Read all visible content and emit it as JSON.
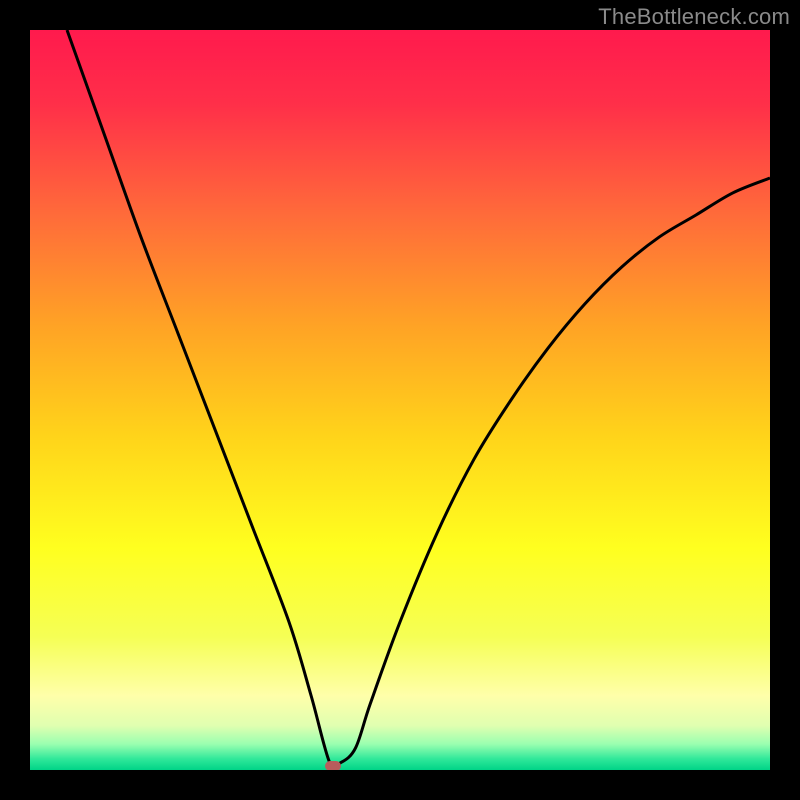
{
  "watermark": "TheBottleneck.com",
  "chart_data": {
    "type": "line",
    "title": "",
    "xlabel": "",
    "ylabel": "",
    "xlim": [
      0,
      100
    ],
    "ylim": [
      0,
      100
    ],
    "grid": false,
    "legend": false,
    "series": [
      {
        "name": "bottleneck-curve",
        "x": [
          5,
          10,
          15,
          20,
          25,
          30,
          35,
          38,
          40.5,
          42,
          44,
          46,
          50,
          55,
          60,
          65,
          70,
          75,
          80,
          85,
          90,
          95,
          100
        ],
        "y": [
          100,
          86,
          72,
          59,
          46,
          33,
          20,
          10,
          1,
          1,
          3,
          9,
          20,
          32,
          42,
          50,
          57,
          63,
          68,
          72,
          75,
          78,
          80
        ]
      }
    ],
    "marker": {
      "x": 41,
      "y": 0.5,
      "color": "#b85c5c"
    },
    "background_gradient_stops": [
      {
        "offset": 0.0,
        "color": "#ff1a4d"
      },
      {
        "offset": 0.1,
        "color": "#ff2f49"
      },
      {
        "offset": 0.25,
        "color": "#ff6b3a"
      },
      {
        "offset": 0.4,
        "color": "#ffa325"
      },
      {
        "offset": 0.55,
        "color": "#ffd41a"
      },
      {
        "offset": 0.7,
        "color": "#ffff1f"
      },
      {
        "offset": 0.82,
        "color": "#f5ff55"
      },
      {
        "offset": 0.9,
        "color": "#ffffaa"
      },
      {
        "offset": 0.94,
        "color": "#e0ffb0"
      },
      {
        "offset": 0.965,
        "color": "#9affb0"
      },
      {
        "offset": 0.985,
        "color": "#30e89a"
      },
      {
        "offset": 1.0,
        "color": "#00d487"
      }
    ]
  },
  "layout": {
    "image_size": 800,
    "plot_inset": 30,
    "curve_stroke": "#000000",
    "curve_width": 3,
    "marker_w": 16,
    "marker_h": 10
  }
}
